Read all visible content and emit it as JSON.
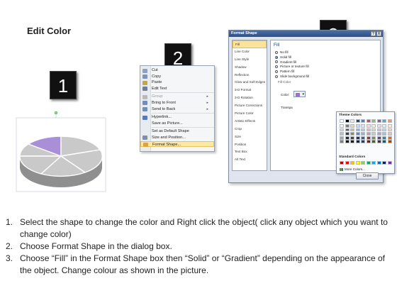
{
  "slide": {
    "title": "Edit Color"
  },
  "steps": [
    "1",
    "2",
    "3"
  ],
  "context_menu": {
    "items": [
      {
        "label": "Cut",
        "icon": "scissors-icon",
        "icon_color": "#8aa2c8",
        "disabled": false,
        "submenu": false
      },
      {
        "label": "Copy",
        "icon": "copy-icon",
        "icon_color": "#7c93bc",
        "disabled": false,
        "submenu": false
      },
      {
        "label": "Paste",
        "icon": "paste-icon",
        "icon_color": "#c9a24b",
        "disabled": false,
        "submenu": false
      },
      {
        "label": "Edit Text",
        "icon": "edit-text-icon",
        "icon_color": "#6f7f99",
        "disabled": false,
        "submenu": false
      },
      {
        "label": "Group",
        "icon": "group-icon",
        "icon_color": "#b9b9b9",
        "disabled": true,
        "submenu": true,
        "sep_before": true
      },
      {
        "label": "Bring to Front",
        "icon": "bring-front-icon",
        "icon_color": "#6d8fc0",
        "disabled": false,
        "submenu": true
      },
      {
        "label": "Send to Back",
        "icon": "send-back-icon",
        "icon_color": "#6d8fc0",
        "disabled": false,
        "submenu": true
      },
      {
        "label": "Hyperlink...",
        "icon": "hyperlink-icon",
        "icon_color": "#4f7bc1",
        "disabled": false,
        "submenu": false,
        "sep_before": true
      },
      {
        "label": "Save as Picture...",
        "icon": "",
        "icon_color": "",
        "disabled": false,
        "submenu": false
      },
      {
        "label": "Set as Default Shape",
        "icon": "",
        "icon_color": "",
        "disabled": false,
        "submenu": false,
        "sep_before": true
      },
      {
        "label": "Size and Position...",
        "icon": "size-position-icon",
        "icon_color": "#7f8fab",
        "disabled": false,
        "submenu": false
      },
      {
        "label": "Format Shape...",
        "icon": "format-shape-icon",
        "icon_color": "#d9a441",
        "disabled": false,
        "submenu": false,
        "highlighted": true
      }
    ]
  },
  "dialog": {
    "title": "Format Shape",
    "help": "?",
    "close_x": "X",
    "categories": [
      "Fill",
      "Line Color",
      "Line Style",
      "Shadow",
      "Reflection",
      "Glow and Soft Edges",
      "3-D Format",
      "3-D Rotation",
      "Picture Corrections",
      "Picture Color",
      "Artistic Effects",
      "Crop",
      "Size",
      "Position",
      "Text Box",
      "Alt Text"
    ],
    "selected_category": "Fill",
    "fill_heading": "Fill",
    "options": [
      {
        "label": "No fill",
        "selected": false
      },
      {
        "label": "Solid fill",
        "selected": true
      },
      {
        "label": "Gradient fill",
        "selected": false
      },
      {
        "label": "Picture or texture fill",
        "selected": false
      },
      {
        "label": "Pattern fill",
        "selected": false
      },
      {
        "label": "Slide background fill",
        "selected": false
      }
    ],
    "fill_color_label": "Fill Color",
    "color_label": "Color:",
    "transparency_label": "Transpa",
    "selected_color": "#9c6fd0",
    "close_button": "Close",
    "picker": {
      "theme_heading": "Theme Colors",
      "standard_heading": "Standard Colors",
      "more_colors": "More Colors...",
      "theme_top": [
        "#ffffff",
        "#000000",
        "#eeece1",
        "#1f497d",
        "#4f81bd",
        "#c0504d",
        "#9bbb59",
        "#8064a2",
        "#4bacc6",
        "#f79646"
      ],
      "theme_shades": [
        [
          "#f2f2f2",
          "#7f7f7f",
          "#ddd9c3",
          "#c6d9f0",
          "#dbe5f1",
          "#f2dcdb",
          "#ebf1dd",
          "#e5e0ec",
          "#dbeef3",
          "#fdeada"
        ],
        [
          "#d8d8d8",
          "#595959",
          "#c4bd97",
          "#8db3e2",
          "#b8cce4",
          "#e5b9b7",
          "#d7e3bc",
          "#ccc1d9",
          "#b7dde8",
          "#fbd5b5"
        ],
        [
          "#bfbfbf",
          "#3f3f3f",
          "#938953",
          "#548dd4",
          "#95b3d7",
          "#d99694",
          "#c3d69b",
          "#b2a2c7",
          "#92cddc",
          "#fac08f"
        ],
        [
          "#a5a5a5",
          "#262626",
          "#494429",
          "#17365d",
          "#366092",
          "#953734",
          "#76923c",
          "#5f497a",
          "#31859b",
          "#e36c09"
        ],
        [
          "#7f7f7f",
          "#0c0c0c",
          "#1d1b10",
          "#0f243e",
          "#244061",
          "#632423",
          "#4f6128",
          "#3f3151",
          "#205867",
          "#974806"
        ]
      ],
      "standard": [
        "#c00000",
        "#ff0000",
        "#ffc000",
        "#ffff00",
        "#92d050",
        "#00b050",
        "#00b0f0",
        "#0070c0",
        "#002060",
        "#7030a0"
      ]
    }
  },
  "pie": {
    "highlight_color": "#a98fd8",
    "face_color": "#c9c9c9",
    "side_color": "#8f8f8f",
    "edge_color": "#ffffff"
  },
  "instructions": [
    {
      "num": "1.",
      "text": "Select the shape to change the color and Right click the object( click any object which you want to change color)"
    },
    {
      "num": "2.",
      "text": "Choose Format Shape in the dialog box."
    },
    {
      "num": "3.",
      "text": "Choose “Fill” in the Format Shape box then “Solid” or “Gradient” depending on the appearance of the object. Change colour as shown in the picture."
    }
  ]
}
